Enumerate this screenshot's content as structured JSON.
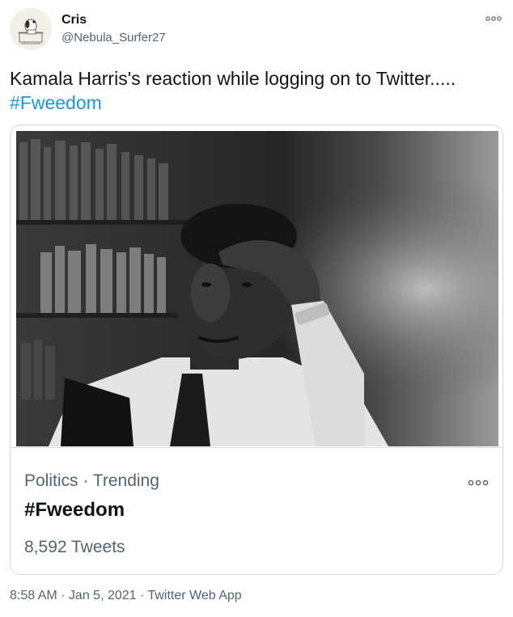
{
  "author": {
    "name": "Cris",
    "handle": "@Nebula_Surfer27",
    "avatar_icon": "snoopy-avatar-icon"
  },
  "tweet": {
    "text": "Kamala Harris's reaction while logging on to Twitter.....",
    "hashtag": "#Fweedom"
  },
  "card": {
    "image_icon": "photo",
    "context": "Politics · Trending",
    "hashtag": "#Fweedom",
    "tweet_count": "8,592 Tweets"
  },
  "meta": {
    "time": "8:58 AM",
    "separator_1": " · ",
    "date": "Jan 5, 2021",
    "separator_2": " · ",
    "source": "Twitter Web App"
  },
  "colors": {
    "link": "#1b95e0",
    "secondary_text": "#536471",
    "primary_text": "#0f1419",
    "border": "#cfd9de"
  }
}
